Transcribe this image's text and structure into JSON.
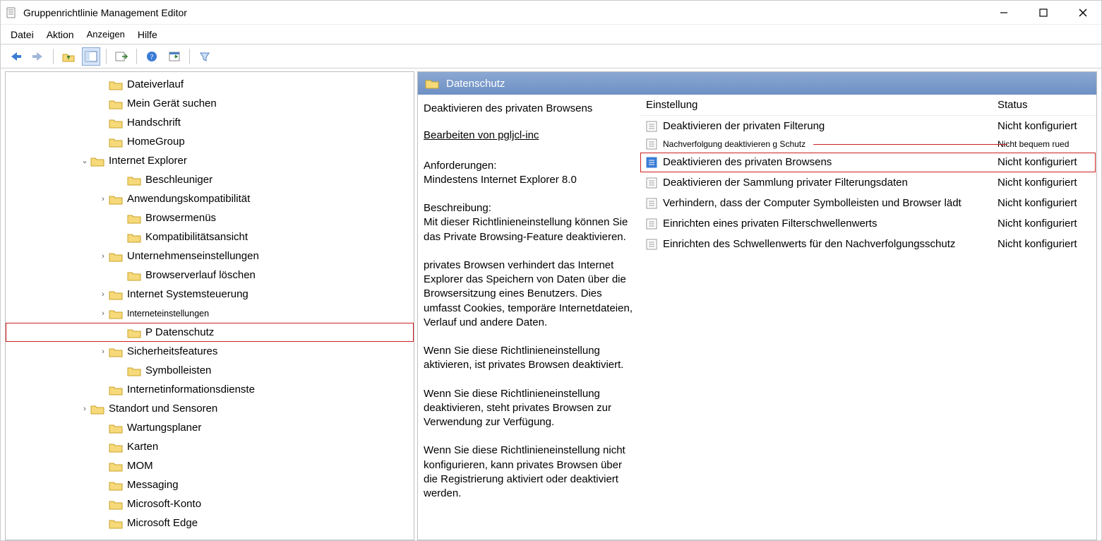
{
  "window": {
    "title": "Gruppenrichtlinie Management Editor"
  },
  "menu": {
    "file": "Datei",
    "action": "Aktion",
    "view": "Anzeigen",
    "help": "Hilfe"
  },
  "tree": {
    "items": [
      {
        "indent": 5,
        "exp": "",
        "label": "Dateiverlauf"
      },
      {
        "indent": 5,
        "exp": "",
        "label": "Mein Gerät suchen"
      },
      {
        "indent": 5,
        "exp": "",
        "label": "Handschrift"
      },
      {
        "indent": 5,
        "exp": "",
        "label": "HomeGroup"
      },
      {
        "indent": 4,
        "exp": "v",
        "label": "Internet Explorer"
      },
      {
        "indent": 6,
        "exp": "",
        "label": "Beschleuniger"
      },
      {
        "indent": 5,
        "exp": ">",
        "label": "Anwendungskompatibilität"
      },
      {
        "indent": 6,
        "exp": "",
        "label": "Browsermenüs"
      },
      {
        "indent": 6,
        "exp": "",
        "label": "Kompatibilitätsansicht"
      },
      {
        "indent": 5,
        "exp": ">",
        "label": "Unternehmenseinstellungen"
      },
      {
        "indent": 6,
        "exp": "",
        "label": "Browserverlauf löschen"
      },
      {
        "indent": 5,
        "exp": ">",
        "label": "Internet Systemsteuerung"
      },
      {
        "indent": 5,
        "exp": ">",
        "label": "Interneteinstellungen",
        "small": true
      },
      {
        "indent": 6,
        "exp": "",
        "label": "P Datenschutz",
        "highlight": true
      },
      {
        "indent": 5,
        "exp": ">",
        "label": "Sicherheitsfeatures"
      },
      {
        "indent": 6,
        "exp": "",
        "label": "Symbolleisten"
      },
      {
        "indent": 5,
        "exp": "",
        "label": "Internetinformationsdienste"
      },
      {
        "indent": 4,
        "exp": ">",
        "label": "Standort und Sensoren"
      },
      {
        "indent": 5,
        "exp": "",
        "label": "Wartungsplaner"
      },
      {
        "indent": 5,
        "exp": "",
        "label": "Karten"
      },
      {
        "indent": 5,
        "exp": "",
        "label": "MOM"
      },
      {
        "indent": 5,
        "exp": "",
        "label": "Messaging"
      },
      {
        "indent": 5,
        "exp": "",
        "label": "Microsoft-Konto"
      },
      {
        "indent": 5,
        "exp": "",
        "label": "Microsoft Edge"
      }
    ]
  },
  "header": {
    "title": "Datenschutz"
  },
  "desc": {
    "title": "Deaktivieren des privaten Browsens",
    "edit": "Bearbeiten von pgljcl-inc",
    "req_head": "Anforderungen:",
    "req_body": "Mindestens Internet Explorer 8.0",
    "d_head": "Beschreibung:",
    "p1": "Mit dieser Richtlinieneinstellung können Sie das Private Browsing-Feature deaktivieren.",
    "p2": "privates Browsen verhindert das Internet Explorer das Speichern von Daten über die Browsersitzung eines Benutzers. Dies umfasst Cookies, temporäre Internetdateien, Verlauf und andere Daten.",
    "p3": "Wenn Sie diese Richtlinieneinstellung aktivieren, ist privates Browsen deaktiviert.",
    "p4": "Wenn Sie diese Richtlinieneinstellung deaktivieren, steht privates Browsen zur Verwendung zur Verfügung.",
    "p5": "Wenn Sie diese Richtlinieneinstellung nicht konfigurieren, kann privates Browsen über die Registrierung aktiviert oder deaktiviert werden."
  },
  "list": {
    "col_setting": "Einstellung",
    "col_status": "Status",
    "rows": [
      {
        "label": "Deaktivieren der privaten Filterung",
        "status": "Nicht konfiguriert"
      },
      {
        "label": "Nachverfolgung deaktivieren g Schutz",
        "status": "Nicht bequem rued",
        "small": true
      },
      {
        "label": "Deaktivieren des privaten Browsens",
        "status": "Nicht konfiguriert",
        "selected": true
      },
      {
        "label": "Deaktivieren der Sammlung privater Filterungsdaten",
        "status": "Nicht konfiguriert"
      },
      {
        "label": "Verhindern, dass der Computer Symbolleisten und Browser lädt",
        "status": "Nicht konfiguriert"
      },
      {
        "label": "Einrichten eines privaten Filterschwellenwerts",
        "status": "Nicht konfiguriert"
      },
      {
        "label": "Einrichten des Schwellenwerts für den Nachverfolgungsschutz",
        "status": "Nicht konfiguriert"
      }
    ]
  }
}
